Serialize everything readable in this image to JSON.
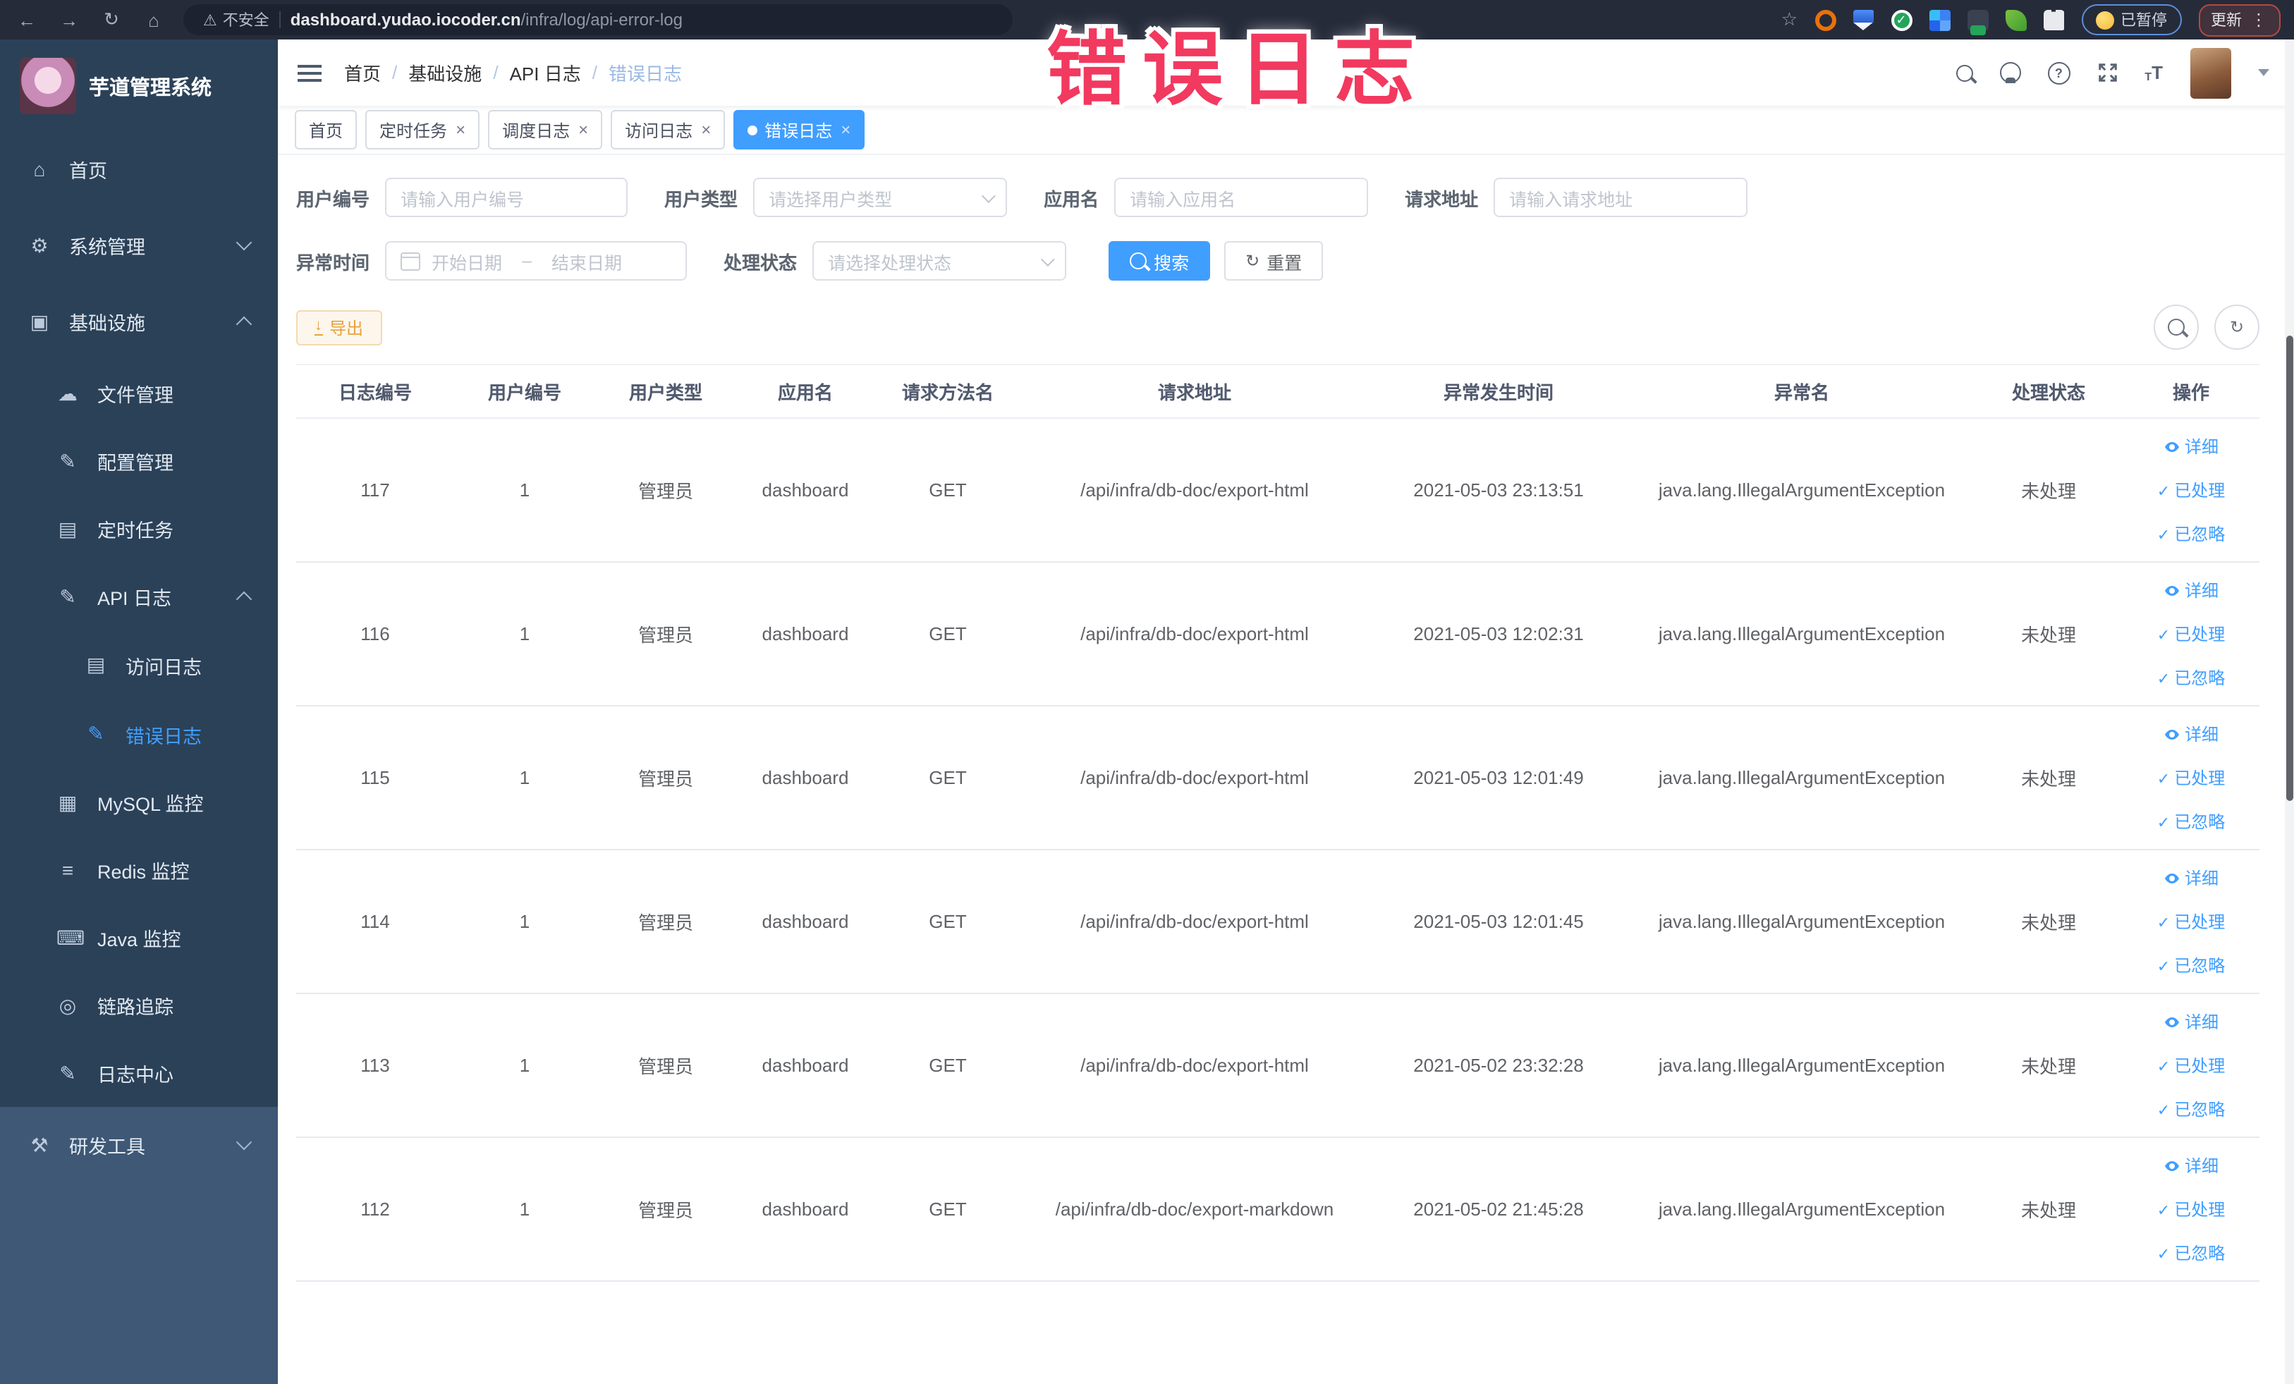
{
  "browser": {
    "back_icon": "←",
    "forward_icon": "→",
    "reload_icon": "↻",
    "home_icon": "⌂",
    "security_label": "不安全",
    "url_host": "dashboard.yudao.iocoder.cn",
    "url_path": "/infra/log/api-error-log",
    "paused_label": "已暂停",
    "update_label": "更新"
  },
  "annotation": {
    "text": "错误日志",
    "color": "#f2395f"
  },
  "sidebar": {
    "title": "芋道管理系统",
    "items": [
      {
        "label": "首页",
        "icon": "home-icon",
        "level": 1
      },
      {
        "label": "系统管理",
        "icon": "gear-icon",
        "level": 1,
        "chevron": "down"
      },
      {
        "label": "基础设施",
        "icon": "monitor-icon",
        "level": 1,
        "chevron": "up"
      },
      {
        "label": "文件管理",
        "icon": "cloud-upload-icon",
        "level": 2
      },
      {
        "label": "配置管理",
        "icon": "config-edit-icon",
        "level": 2
      },
      {
        "label": "定时任务",
        "icon": "timer-icon",
        "level": 2
      },
      {
        "label": "API 日志",
        "icon": "api-log-icon",
        "level": 2,
        "chevron": "up"
      },
      {
        "label": "访问日志",
        "icon": "access-log-icon",
        "level": 3
      },
      {
        "label": "错误日志",
        "icon": "error-log-icon",
        "level": 3,
        "active": true
      },
      {
        "label": "MySQL 监控",
        "icon": "mysql-monitor-icon",
        "level": 2
      },
      {
        "label": "Redis 监控",
        "icon": "redis-monitor-icon",
        "level": 2
      },
      {
        "label": "Java 监控",
        "icon": "java-monitor-icon",
        "level": 2
      },
      {
        "label": "链路追踪",
        "icon": "trace-eye-icon",
        "level": 2
      },
      {
        "label": "日志中心",
        "icon": "log-center-icon",
        "level": 2
      },
      {
        "label": "研发工具",
        "icon": "devtools-icon",
        "level": 1,
        "chevron": "down",
        "highlight": true
      }
    ]
  },
  "header": {
    "breadcrumbs": [
      "首页",
      "基础设施",
      "API 日志",
      "错误日志"
    ],
    "separator": "/"
  },
  "tabs": [
    {
      "label": "首页",
      "closable": false,
      "active": false
    },
    {
      "label": "定时任务",
      "closable": true,
      "active": false
    },
    {
      "label": "调度日志",
      "closable": true,
      "active": false
    },
    {
      "label": "访问日志",
      "closable": true,
      "active": false
    },
    {
      "label": "错误日志",
      "closable": true,
      "active": true
    }
  ],
  "filters": {
    "user_id": {
      "label": "用户编号",
      "placeholder": "请输入用户编号"
    },
    "user_type": {
      "label": "用户类型",
      "placeholder": "请选择用户类型"
    },
    "app_name": {
      "label": "应用名",
      "placeholder": "请输入应用名"
    },
    "request_url": {
      "label": "请求地址",
      "placeholder": "请输入请求地址"
    },
    "exception_time": {
      "label": "异常时间",
      "start_placeholder": "开始日期",
      "separator": "–",
      "end_placeholder": "结束日期"
    },
    "process_status": {
      "label": "处理状态",
      "placeholder": "请选择处理状态"
    },
    "search_label": "搜索",
    "reset_label": "重置"
  },
  "toolbar": {
    "export_label": "导出"
  },
  "table": {
    "columns": [
      "日志编号",
      "用户编号",
      "用户类型",
      "应用名",
      "请求方法名",
      "请求地址",
      "异常发生时间",
      "异常名",
      "处理状态",
      "操作"
    ],
    "actions": [
      {
        "label": "详细",
        "icon": "eye-icon"
      },
      {
        "label": "已处理",
        "icon": "check-icon"
      },
      {
        "label": "已忽略",
        "icon": "check-icon"
      }
    ],
    "rows": [
      {
        "id": "117",
        "user_id": "1",
        "user_type": "管理员",
        "app": "dashboard",
        "method": "GET",
        "url": "/api/infra/db-doc/export-html",
        "time": "2021-05-03 23:13:51",
        "exception": "java.lang.IllegalArgumentException",
        "status": "未处理"
      },
      {
        "id": "116",
        "user_id": "1",
        "user_type": "管理员",
        "app": "dashboard",
        "method": "GET",
        "url": "/api/infra/db-doc/export-html",
        "time": "2021-05-03 12:02:31",
        "exception": "java.lang.IllegalArgumentException",
        "status": "未处理"
      },
      {
        "id": "115",
        "user_id": "1",
        "user_type": "管理员",
        "app": "dashboard",
        "method": "GET",
        "url": "/api/infra/db-doc/export-html",
        "time": "2021-05-03 12:01:49",
        "exception": "java.lang.IllegalArgumentException",
        "status": "未处理"
      },
      {
        "id": "114",
        "user_id": "1",
        "user_type": "管理员",
        "app": "dashboard",
        "method": "GET",
        "url": "/api/infra/db-doc/export-html",
        "time": "2021-05-03 12:01:45",
        "exception": "java.lang.IllegalArgumentException",
        "status": "未处理"
      },
      {
        "id": "113",
        "user_id": "1",
        "user_type": "管理员",
        "app": "dashboard",
        "method": "GET",
        "url": "/api/infra/db-doc/export-html",
        "time": "2021-05-02 23:32:28",
        "exception": "java.lang.IllegalArgumentException",
        "status": "未处理"
      },
      {
        "id": "112",
        "user_id": "1",
        "user_type": "管理员",
        "app": "dashboard",
        "method": "GET",
        "url": "/api/infra/db-doc/export-markdown",
        "time": "2021-05-02 21:45:28",
        "exception": "java.lang.IllegalArgumentException",
        "status": "未处理"
      }
    ]
  }
}
